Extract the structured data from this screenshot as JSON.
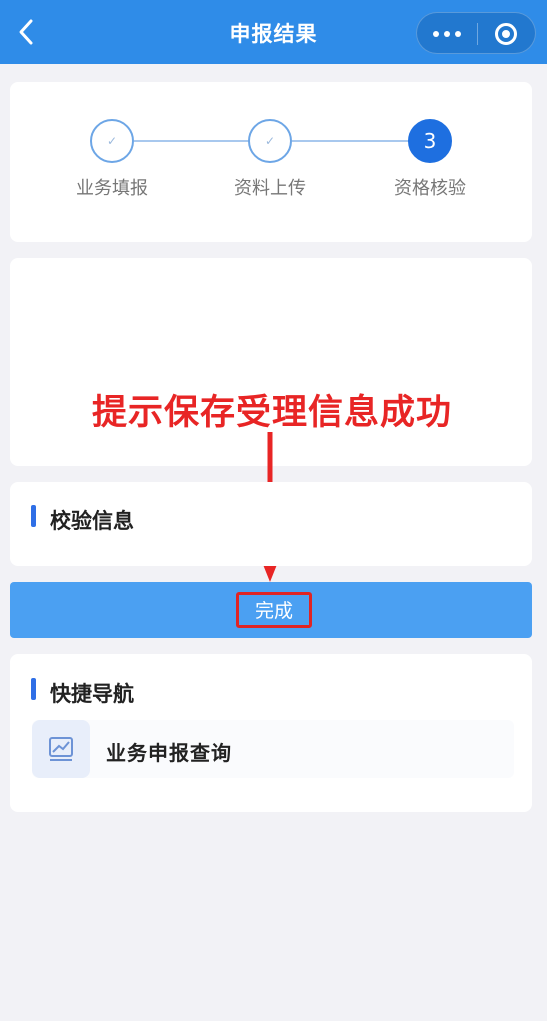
{
  "header": {
    "title": "申报结果"
  },
  "steps": [
    {
      "label": "业务填报",
      "marker": "✓"
    },
    {
      "label": "资料上传",
      "marker": "✓"
    },
    {
      "label": "资格核验",
      "marker": "3"
    }
  ],
  "annotation": {
    "text": "提示保存受理信息成功",
    "color": "#e82525"
  },
  "verify_section": {
    "title": "校验信息"
  },
  "done_button": {
    "label": "完成"
  },
  "quick_nav": {
    "title": "快捷导航",
    "items": [
      {
        "label": "业务申报查询",
        "icon": "chart-icon"
      }
    ]
  },
  "colors": {
    "header": "#2f8ce8",
    "accent": "#1e6fe0",
    "button": "#4ba0f2",
    "highlight": "#e02424"
  }
}
